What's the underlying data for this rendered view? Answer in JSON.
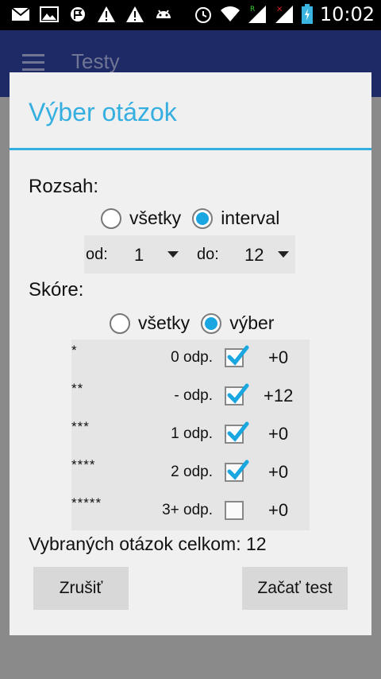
{
  "statusbar": {
    "time": "10:02",
    "icons": [
      "mail-icon",
      "image-icon",
      "flag-icon",
      "warning-icon",
      "warning-icon",
      "android-icon",
      "alarm-icon",
      "wifi-icon",
      "signal-icon",
      "signal-icon",
      "battery-icon"
    ]
  },
  "appbar": {
    "title": "Testy"
  },
  "dialog": {
    "title": "Výber otázok",
    "range": {
      "label": "Rozsah:",
      "option_all": "všetky",
      "option_interval": "interval",
      "selected": "interval",
      "from_label": "od:",
      "from_value": "1",
      "to_label": "do:",
      "to_value": "12"
    },
    "score": {
      "label": "Skóre:",
      "option_all": "všetky",
      "option_select": "výber",
      "selected": "výber",
      "rows": [
        {
          "stars": "*",
          "answers": "0 odp.",
          "checked": true,
          "count": "+0"
        },
        {
          "stars": "**",
          "answers": "- odp.",
          "checked": true,
          "count": "+12"
        },
        {
          "stars": "***",
          "answers": "1 odp.",
          "checked": true,
          "count": "+0"
        },
        {
          "stars": "****",
          "answers": "2 odp.",
          "checked": true,
          "count": "+0"
        },
        {
          "stars": "*****",
          "answers": "3+ odp.",
          "checked": false,
          "count": "+0"
        }
      ]
    },
    "total_text": "Vybraných otázok celkom: 12",
    "cancel_label": "Zrušiť",
    "start_label": "Začať test"
  },
  "colors": {
    "accent": "#35aee0",
    "appbar": "#1e2a66",
    "dim": "#8a8a8a"
  }
}
